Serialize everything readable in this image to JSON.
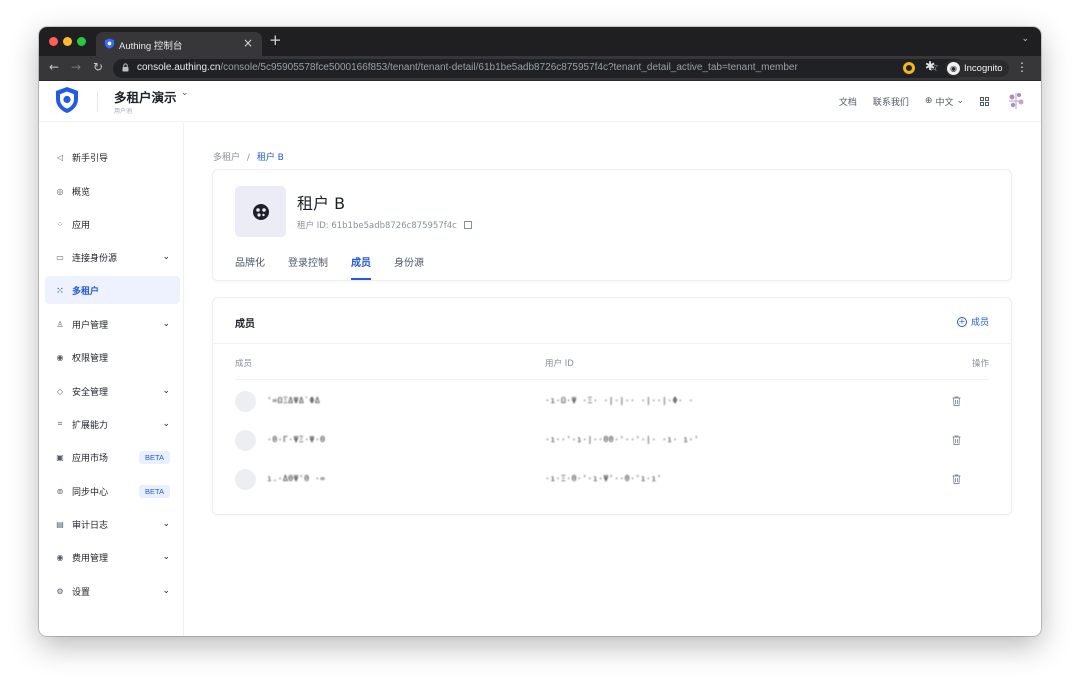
{
  "browser": {
    "tab_title": "Authing 控制台",
    "url_host": "console.authing.cn",
    "url_path": "/console/5c95905578fce5000166f853/tenant/tenant-detail/61b1be5adb8726c875957f4c?tenant_detail_active_tab=tenant_member",
    "incognito_label": "Incognito"
  },
  "header": {
    "org_name": "多租户演示",
    "org_sub": "用户池",
    "docs": "文档",
    "contact": "联系我们",
    "language": "中文"
  },
  "sidebar": {
    "items": [
      {
        "label": "新手引导",
        "icon": "send-icon"
      },
      {
        "label": "概览",
        "icon": "dashboard-icon"
      },
      {
        "label": "应用",
        "icon": "apps-icon"
      },
      {
        "label": "连接身份源",
        "icon": "id-card-icon"
      },
      {
        "label": "多租户",
        "icon": "tenant-icon"
      },
      {
        "label": "用户管理",
        "icon": "user-icon"
      },
      {
        "label": "权限管理",
        "icon": "permission-icon"
      },
      {
        "label": "安全管理",
        "icon": "shield-icon"
      },
      {
        "label": "扩展能力",
        "icon": "extension-icon"
      },
      {
        "label": "应用市场",
        "icon": "market-icon",
        "badge": "BETA"
      },
      {
        "label": "同步中心",
        "icon": "sync-icon",
        "badge": "BETA"
      },
      {
        "label": "审计日志",
        "icon": "log-icon"
      },
      {
        "label": "费用管理",
        "icon": "billing-icon"
      },
      {
        "label": "设置",
        "icon": "gear-icon"
      }
    ],
    "active_index": 4
  },
  "breadcrumb": {
    "root": "多租户",
    "separator": "/",
    "current": "租户 B"
  },
  "tenant": {
    "name": "租户 B",
    "id_label": "租户 ID:",
    "id_value": "61b1be5adb8726c875957f4c"
  },
  "tabs": [
    "品牌化",
    "登录控制",
    "成员",
    "身份源"
  ],
  "active_tab": 2,
  "members": {
    "title": "成员",
    "add_label": "成员",
    "columns": [
      "成员",
      "用户 ID",
      "操作"
    ],
    "rows": [
      {
        "name": "'=ΩΞΔΨΔ`ΦΔ",
        "user_id": "·ı·Ω·Ψ ·Ξ· ·|·|·· ·|··|·Φ· ·"
      },
      {
        "name": "·Θ·Γ·ΨΞ·Ψ·Θ",
        "user_id": "·ı··'·ı·|··ΘΘ·'··'·|· ·ı· ı·'"
      },
      {
        "name": "ı.·ΔΘΨ'Θ ·=",
        "user_id": "·ı·Ξ·Θ·'·ı·Ψ'··Θ·'ı·ı'"
      }
    ]
  },
  "colors": {
    "accent": "#215ae5",
    "active_bg": "#eef2ff"
  }
}
